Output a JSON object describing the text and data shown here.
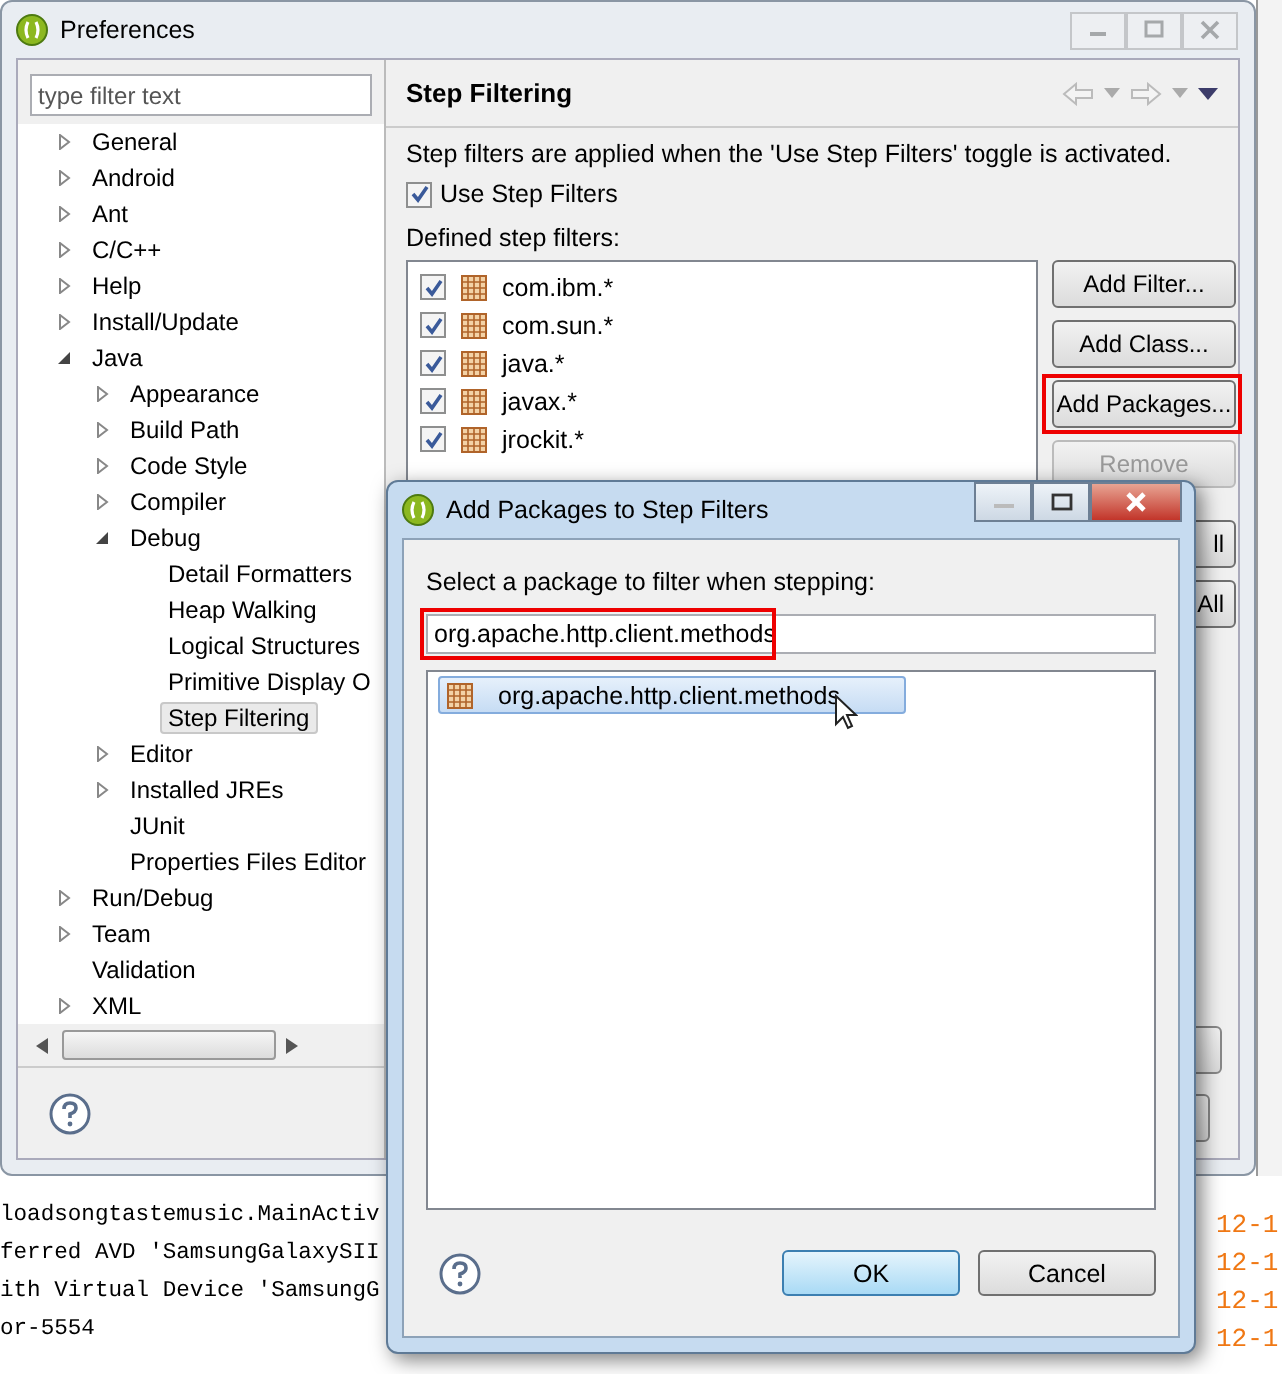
{
  "preferences_window": {
    "title": "Preferences",
    "filter_field": {
      "placeholder": "type filter text"
    },
    "tree": [
      {
        "label": "General",
        "expanded": false,
        "selected": false
      },
      {
        "label": "Android",
        "expanded": false,
        "selected": false
      },
      {
        "label": "Ant",
        "expanded": false,
        "selected": false
      },
      {
        "label": "C/C++",
        "expanded": false,
        "selected": false
      },
      {
        "label": "Help",
        "expanded": false,
        "selected": false
      },
      {
        "label": "Install/Update",
        "expanded": false,
        "selected": false
      },
      {
        "label": "Java",
        "expanded": true,
        "selected": false,
        "children": [
          {
            "label": "Appearance",
            "expanded": false,
            "selected": false
          },
          {
            "label": "Build Path",
            "expanded": false,
            "selected": false
          },
          {
            "label": "Code Style",
            "expanded": false,
            "selected": false
          },
          {
            "label": "Compiler",
            "expanded": false,
            "selected": false
          },
          {
            "label": "Debug",
            "expanded": true,
            "selected": false,
            "children": [
              {
                "label": "Detail Formatters",
                "selected": false
              },
              {
                "label": "Heap Walking",
                "selected": false
              },
              {
                "label": "Logical Structures",
                "selected": false
              },
              {
                "label": "Primitive Display O",
                "selected": false
              },
              {
                "label": "Step Filtering",
                "selected": true
              }
            ]
          },
          {
            "label": "Editor",
            "expanded": false,
            "selected": false
          },
          {
            "label": "Installed JREs",
            "expanded": false,
            "selected": false
          },
          {
            "label": "JUnit",
            "selected": false
          },
          {
            "label": "Properties Files Editor",
            "selected": false
          }
        ]
      },
      {
        "label": "Run/Debug",
        "expanded": false,
        "selected": false
      },
      {
        "label": "Team",
        "expanded": false,
        "selected": false
      },
      {
        "label": "Validation",
        "selected": false
      },
      {
        "label": "XML",
        "expanded": false,
        "selected": false
      }
    ],
    "page": {
      "title": "Step Filtering",
      "description": "Step filters are applied when the 'Use Step Filters' toggle is activated.",
      "use_step_filters": {
        "label": "Use Step Filters",
        "checked": true
      },
      "list_label": "Defined step filters:",
      "filters": [
        {
          "label": "com.ibm.*",
          "checked": true
        },
        {
          "label": "com.sun.*",
          "checked": true
        },
        {
          "label": "java.*",
          "checked": true
        },
        {
          "label": "javax.*",
          "checked": true
        },
        {
          "label": "jrockit.*",
          "checked": true
        }
      ],
      "buttons": [
        {
          "label": "Add Filter...",
          "disabled": false,
          "highlighted": false
        },
        {
          "label": "Add Class...",
          "disabled": false,
          "highlighted": false
        },
        {
          "label": "Add Packages...",
          "disabled": false,
          "highlighted": true
        },
        {
          "label": "Remove",
          "disabled": true,
          "highlighted": false
        },
        {
          "label": "ll",
          "disabled": false,
          "highlighted": false
        },
        {
          "label": "All",
          "disabled": false,
          "highlighted": false
        }
      ]
    }
  },
  "dialog": {
    "title": "Add Packages to Step Filters",
    "prompt": "Select a package to filter when stepping:",
    "input": {
      "value": "org.apache.http.client.methods",
      "highlighted": true
    },
    "packages": [
      {
        "label": "org.apache.http.client.methods",
        "selected": true
      }
    ],
    "buttons": [
      {
        "label": "OK",
        "default": true
      },
      {
        "label": "Cancel",
        "default": false
      }
    ]
  },
  "console": {
    "lines": [
      "loadsongtastemusic.MainActiv",
      "ferred AVD 'SamsungGalaxySII",
      "ith Virtual Device 'SamsungG",
      "or-5554"
    ],
    "timestamps": [
      "12-1",
      "12-1",
      "12-1",
      "12-1"
    ]
  }
}
